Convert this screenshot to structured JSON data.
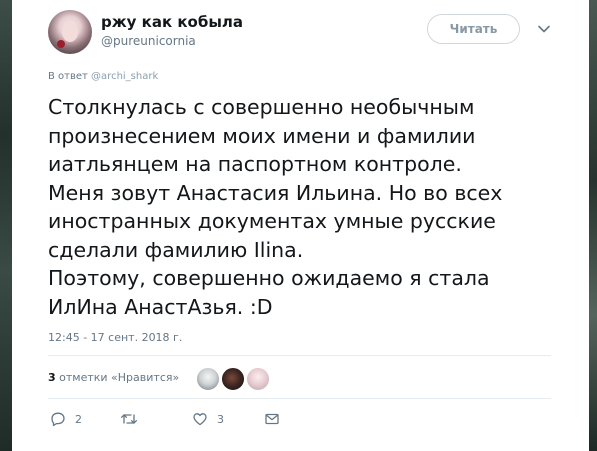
{
  "author": {
    "display_name": "ржу как кобыла",
    "handle": "@pureunicornia"
  },
  "follow_button": {
    "label": "Читать"
  },
  "reply_to": {
    "prefix": "В ответ",
    "mention": "@archi_shark"
  },
  "tweet": {
    "text": "Столкнулась с совершенно необычным\nпроизнесением моих имени и фамилии\nиатльянцем на паспортном контроле.\nМеня зовут Анастасия Ильина. Но во всех\nиностранных документах умные русские\nсделали фамилию Ilina.\nПоэтому, совершенно ожидаемо я стала\nИлИна АнастАзья. :D",
    "timestamp": "12:45 - 17 сент. 2018 г."
  },
  "engagement": {
    "likes_count": "3",
    "likes_label": "отметки «Нравится»"
  },
  "actions": {
    "reply_count": "2",
    "retweet_count": "",
    "like_count": "3"
  },
  "icons": {
    "reply": "reply-icon",
    "retweet": "retweet-icon",
    "like": "heart-icon",
    "message": "envelope-icon",
    "menu": "chevron-down-icon"
  },
  "colors": {
    "text_primary": "#14171a",
    "text_secondary": "#657786",
    "divider": "#e6ecf0"
  }
}
